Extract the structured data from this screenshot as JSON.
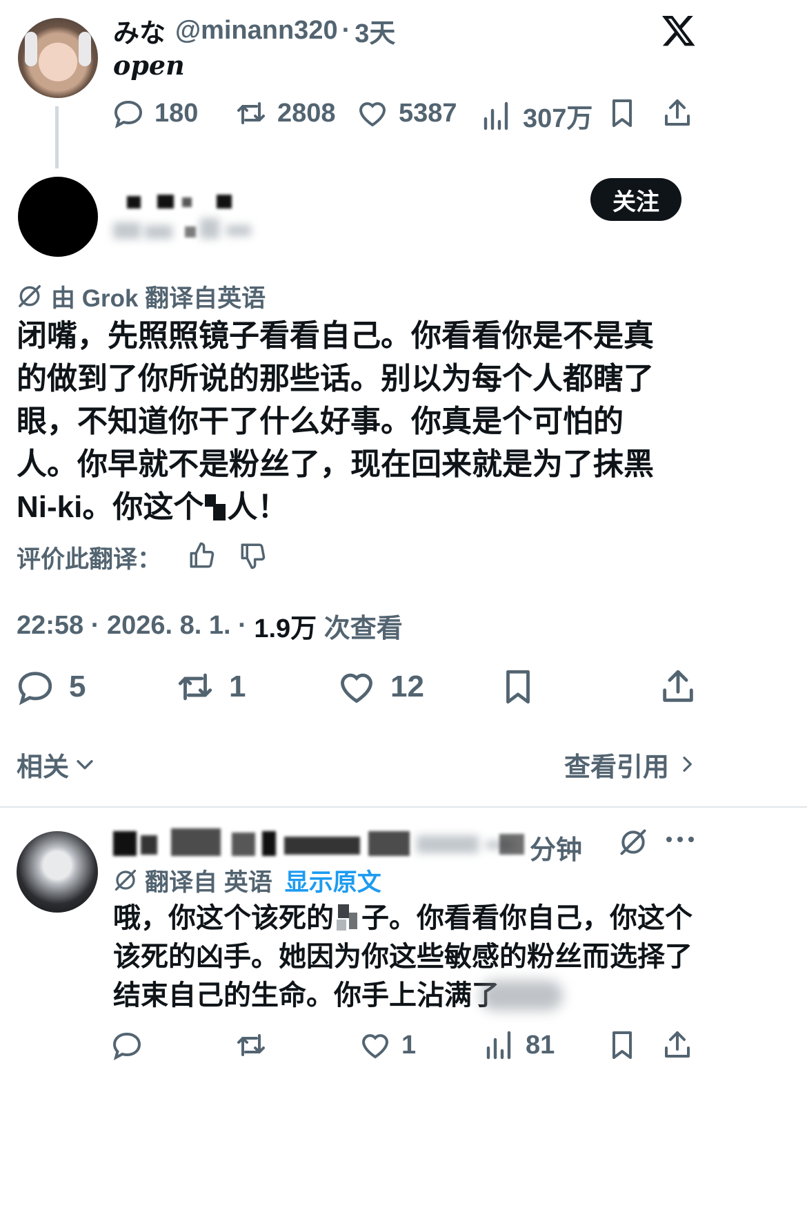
{
  "quoted_tweet": {
    "display_name": "みな",
    "handle": "@minann320",
    "time": "3天",
    "text": "open",
    "stats": {
      "replies": "180",
      "retweets": "2808",
      "likes": "5387",
      "views": "307万"
    }
  },
  "main_tweet": {
    "follow_label": "关注",
    "translation_label": "由 Grok 翻译自英语",
    "body": [
      "闭嘴，先照照镜子看看自己。你看看你是不是真",
      "的做到了你所说的那些话。别以为每个人都瞎了",
      "眼，不知道你干了什么好事。你真是个可怕的",
      "人。你早就不是粉丝了，现在回来就是为了抹黑"
    ],
    "body_last_start": "Ni-ki。你这个",
    "body_last_end": "人！",
    "rate_label": "评价此翻译：",
    "timestamp": "22:58 · 2026. 8. 1. · ",
    "views_count": "1.9万",
    "views_label": " 次查看",
    "stats": {
      "replies": "5",
      "retweets": "1",
      "likes": "12"
    }
  },
  "related": {
    "label": "相关",
    "quotes_label": "查看引用"
  },
  "reply": {
    "name_suffix": "分钟",
    "translation_prefix": "翻译自 英语",
    "show_original": "显示原文",
    "line1_start": "哦，你这个该死的",
    "line1_end": "子。你看看你自己，你这个",
    "line2": "该死的凶手。她因为你这些敏感的粉丝而选择了",
    "line3": "结束自己的生命。你手上沾满了",
    "stats": {
      "likes": "1",
      "views": "81"
    }
  },
  "colors": {
    "text": "#0f1419",
    "muted": "#536471",
    "link": "#1d9bf0",
    "follow_bg": "#0f1419"
  }
}
